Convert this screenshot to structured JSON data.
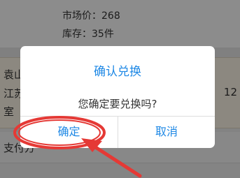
{
  "product": {
    "line_top": "",
    "market_price": "市场价：268",
    "stock": "库存：35件"
  },
  "address": {
    "name_partial": "袁山",
    "line1_partial": "江苏",
    "line2_partial": "室",
    "number_partial": "12"
  },
  "payment": {
    "label_partial": "支付方"
  },
  "dialog": {
    "title": "确认兑换",
    "message": "您确定要兑换吗?",
    "confirm_label": "确定",
    "cancel_label": "取消"
  },
  "colors": {
    "accent": "#1e88e5",
    "annotation": "#e53935",
    "overlay": "rgba(0,0,0,0.45)"
  }
}
